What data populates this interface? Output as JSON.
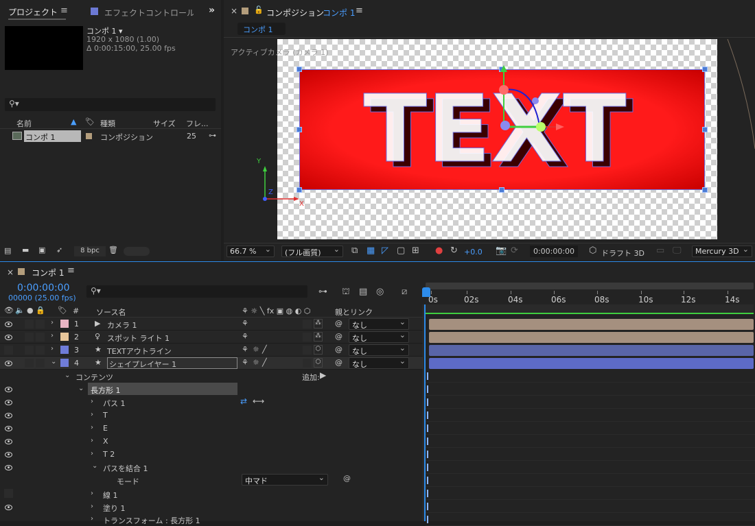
{
  "project_panel": {
    "tab_project": "プロジェクト",
    "tab_effects": "エフェクトコントロール",
    "item_name": "コンポ 1 ▾",
    "item_res": "1920 x 1080 (1.00)",
    "item_dur": "Δ 0:00:15:00, 25.00 fps",
    "search_placeholder": "",
    "col_name": "名前",
    "col_type": "種類",
    "col_size": "サイズ",
    "col_frame": "フレ...",
    "row_name": "コンポ 1",
    "row_type": "コンポジション",
    "row_frame": "25",
    "bpc": "8 bpc"
  },
  "viewer": {
    "tab_title": "コンポジション",
    "tab_comp": "コンポ 1",
    "subtab": "コンポ 1",
    "camera_label": "アクティブカメラ (カメラ 1)",
    "canvas_text": "TEXT",
    "zoom": "66.7 %",
    "quality": "(フル画質)",
    "exposure": "+0.0",
    "timecode": "0:00:00:00",
    "draft3d": "ドラフト 3D",
    "renderer": "Mercury 3D",
    "axis_y": "Y",
    "axis_z": "Z",
    "axis_x": "X"
  },
  "timeline": {
    "tab": "コンポ 1",
    "timecode": "0:00:00:00",
    "frames": "00000 (25.00 fps)",
    "col_source": "ソース名",
    "col_parent": "親とリンク",
    "ticks": [
      "0s",
      "02s",
      "04s",
      "06s",
      "08s",
      "10s",
      "12s",
      "14s"
    ],
    "layers": [
      {
        "num": "1",
        "name": "カメラ 1",
        "parent": "なし",
        "color": "#e9b5c4",
        "bar": "#a5907f"
      },
      {
        "num": "2",
        "name": "スポット ライト 1",
        "parent": "なし",
        "color": "#e8c69a",
        "bar": "#a5907f"
      },
      {
        "num": "3",
        "name": "TEXTアウトライン",
        "parent": "なし",
        "color": "#6f7cd8",
        "bar": "#5965a8"
      },
      {
        "num": "4",
        "name": "シェイプレイヤー 1",
        "parent": "なし",
        "color": "#6f7cd8",
        "bar": "#5d6bc7"
      }
    ],
    "contents_label": "コンテンツ",
    "add_label": "追加:",
    "rect_group": "長方形 1",
    "props": [
      "パス 1",
      "T",
      "E",
      "X",
      "T 2",
      "パスを結合 1"
    ],
    "mode_label": "モード",
    "mode_value": "中マド",
    "stroke": "線 1",
    "fill": "塗り 1",
    "transform": "トランスフォーム : 長方形 1"
  },
  "colors": {
    "accent": "#4a9eff",
    "canvas_red": "#ff0000"
  }
}
